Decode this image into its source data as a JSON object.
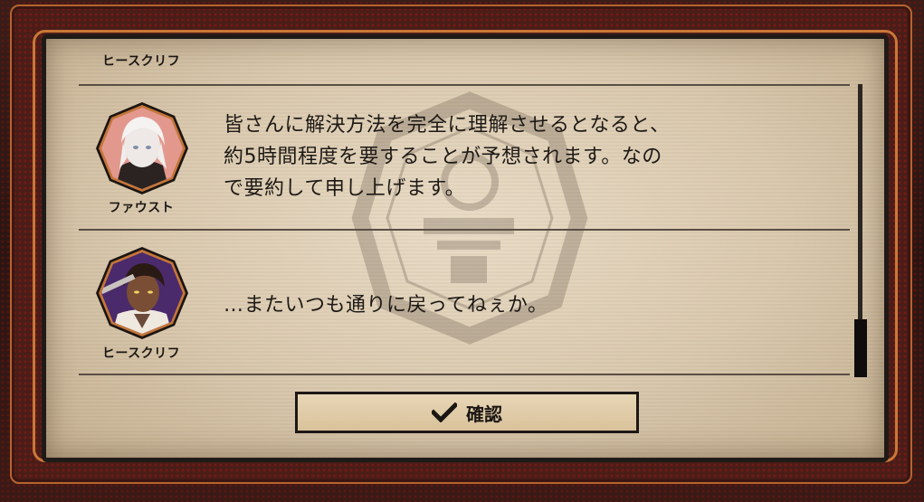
{
  "dialog": {
    "entries": [
      {
        "speaker": "ヒースクリフ",
        "text": "",
        "partial": true
      },
      {
        "speaker": "ファウスト",
        "lines": [
          "皆さんに解決方法を完全に理解させるとなると、",
          "約5時間程度を要することが予想されます。なの",
          "で要約して申し上げます。"
        ]
      },
      {
        "speaker": "ヒースクリフ",
        "lines": [
          "…またいつも通りに戻ってねぇか。"
        ]
      }
    ],
    "confirm_label": "確認"
  },
  "colors": {
    "frame_red": "#4a1d18",
    "frame_orange": "#c97838",
    "panel_parchment": "#e2d3bb",
    "text_dark": "#1d1915"
  },
  "icons": {
    "confirm": "checkmark-icon"
  }
}
